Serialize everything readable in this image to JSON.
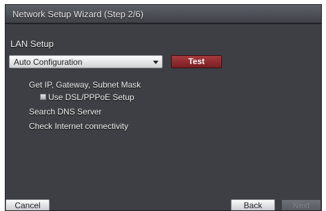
{
  "window": {
    "title": "Network Setup Wizard (Step 2/6)"
  },
  "lan_setup": {
    "label": "LAN Setup",
    "dropdown_value": "Auto Configuration",
    "test_button": "Test"
  },
  "steps": {
    "get_ip": "Get IP, Gateway, Subnet Mask",
    "use_dsl": "Use DSL/PPPoE Setup",
    "use_dsl_checked": false,
    "search_dns": "Search DNS Server",
    "check_internet": "Check Internet connectivity"
  },
  "footer": {
    "cancel": "Cancel",
    "back": "Back",
    "next": "Next"
  }
}
